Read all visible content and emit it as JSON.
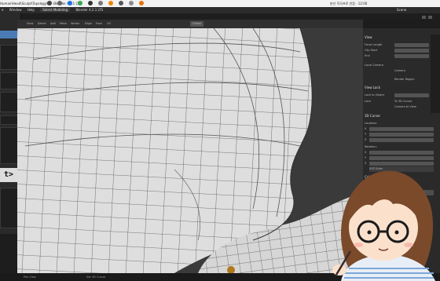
{
  "os_bar": {
    "title": "Human\\Head\\Sculpt\\Topology\\...  - Blender 4.2.1 LTS",
    "tray": "분산 작곡프로 안음 · 12:00"
  },
  "menu": {
    "items": [
      "e",
      "Window",
      "Help"
    ],
    "button_label": "Select Modeling",
    "version": "Blender 4.2.1 LTS",
    "scene_label": "Scene"
  },
  "editor_header": {
    "items": [
      "View",
      "Select",
      "Add",
      "Mesh",
      "Vertex",
      "Edge",
      "Face",
      "UV"
    ],
    "global_label": "Global"
  },
  "viewport": {
    "perspective_label": "User Perspective",
    "object_label": "(0) Body"
  },
  "left_panel": {
    "button_glyph": "t>"
  },
  "right_panel": {
    "view_section": "View",
    "focal_length_label": "Focal Length",
    "clip_start_label": "Clip Start",
    "clip_end_label": "End",
    "local_camera_label": "Local Camera",
    "camera_field_label": "Camera",
    "render_region_label": "Render Region",
    "view_lock_section": "View Lock",
    "lock_to_object_label": "Lock to Object",
    "lock_label": "Lock",
    "to_3d_cursor_label": "To 3D Cursor",
    "camera_to_view_label": "Camera to View",
    "cursor_section": "3D Cursor",
    "location_label": "Location:",
    "x_label": "X",
    "y_label": "Y",
    "z_label": "Z",
    "rotation_label": "Rotation:",
    "xyz_euler_label": "XYZ Euler",
    "collections_section": "Collections",
    "annotations_section": "Annotations",
    "new_button": "New"
  },
  "status_bar": {
    "left": "Pan View",
    "right": "Set 3D Cursor"
  },
  "colors": {
    "viewport_bg": "#3a3a3a",
    "mesh_fill": "#dcdcdc",
    "mesh_line": "#4a4a4a",
    "accent_blue": "#4a7bb7"
  }
}
